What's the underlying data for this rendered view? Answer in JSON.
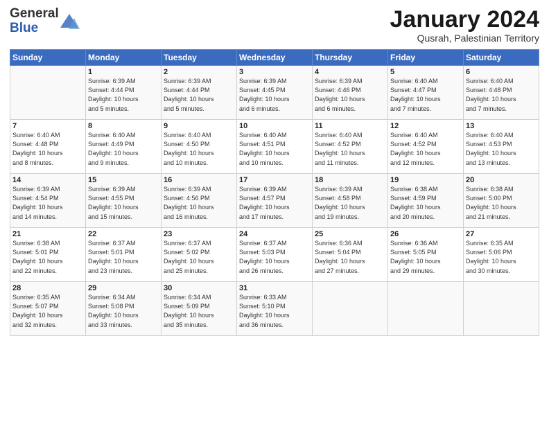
{
  "header": {
    "logo_general": "General",
    "logo_blue": "Blue",
    "month_title": "January 2024",
    "subtitle": "Qusrah, Palestinian Territory"
  },
  "days_of_week": [
    "Sunday",
    "Monday",
    "Tuesday",
    "Wednesday",
    "Thursday",
    "Friday",
    "Saturday"
  ],
  "weeks": [
    [
      {
        "day": "",
        "info": ""
      },
      {
        "day": "1",
        "info": "Sunrise: 6:39 AM\nSunset: 4:44 PM\nDaylight: 10 hours\nand 5 minutes."
      },
      {
        "day": "2",
        "info": "Sunrise: 6:39 AM\nSunset: 4:44 PM\nDaylight: 10 hours\nand 5 minutes."
      },
      {
        "day": "3",
        "info": "Sunrise: 6:39 AM\nSunset: 4:45 PM\nDaylight: 10 hours\nand 6 minutes."
      },
      {
        "day": "4",
        "info": "Sunrise: 6:39 AM\nSunset: 4:46 PM\nDaylight: 10 hours\nand 6 minutes."
      },
      {
        "day": "5",
        "info": "Sunrise: 6:40 AM\nSunset: 4:47 PM\nDaylight: 10 hours\nand 7 minutes."
      },
      {
        "day": "6",
        "info": "Sunrise: 6:40 AM\nSunset: 4:48 PM\nDaylight: 10 hours\nand 7 minutes."
      }
    ],
    [
      {
        "day": "7",
        "info": "Sunrise: 6:40 AM\nSunset: 4:48 PM\nDaylight: 10 hours\nand 8 minutes."
      },
      {
        "day": "8",
        "info": "Sunrise: 6:40 AM\nSunset: 4:49 PM\nDaylight: 10 hours\nand 9 minutes."
      },
      {
        "day": "9",
        "info": "Sunrise: 6:40 AM\nSunset: 4:50 PM\nDaylight: 10 hours\nand 10 minutes."
      },
      {
        "day": "10",
        "info": "Sunrise: 6:40 AM\nSunset: 4:51 PM\nDaylight: 10 hours\nand 10 minutes."
      },
      {
        "day": "11",
        "info": "Sunrise: 6:40 AM\nSunset: 4:52 PM\nDaylight: 10 hours\nand 11 minutes."
      },
      {
        "day": "12",
        "info": "Sunrise: 6:40 AM\nSunset: 4:52 PM\nDaylight: 10 hours\nand 12 minutes."
      },
      {
        "day": "13",
        "info": "Sunrise: 6:40 AM\nSunset: 4:53 PM\nDaylight: 10 hours\nand 13 minutes."
      }
    ],
    [
      {
        "day": "14",
        "info": "Sunrise: 6:39 AM\nSunset: 4:54 PM\nDaylight: 10 hours\nand 14 minutes."
      },
      {
        "day": "15",
        "info": "Sunrise: 6:39 AM\nSunset: 4:55 PM\nDaylight: 10 hours\nand 15 minutes."
      },
      {
        "day": "16",
        "info": "Sunrise: 6:39 AM\nSunset: 4:56 PM\nDaylight: 10 hours\nand 16 minutes."
      },
      {
        "day": "17",
        "info": "Sunrise: 6:39 AM\nSunset: 4:57 PM\nDaylight: 10 hours\nand 17 minutes."
      },
      {
        "day": "18",
        "info": "Sunrise: 6:39 AM\nSunset: 4:58 PM\nDaylight: 10 hours\nand 19 minutes."
      },
      {
        "day": "19",
        "info": "Sunrise: 6:38 AM\nSunset: 4:59 PM\nDaylight: 10 hours\nand 20 minutes."
      },
      {
        "day": "20",
        "info": "Sunrise: 6:38 AM\nSunset: 5:00 PM\nDaylight: 10 hours\nand 21 minutes."
      }
    ],
    [
      {
        "day": "21",
        "info": "Sunrise: 6:38 AM\nSunset: 5:01 PM\nDaylight: 10 hours\nand 22 minutes."
      },
      {
        "day": "22",
        "info": "Sunrise: 6:37 AM\nSunset: 5:01 PM\nDaylight: 10 hours\nand 23 minutes."
      },
      {
        "day": "23",
        "info": "Sunrise: 6:37 AM\nSunset: 5:02 PM\nDaylight: 10 hours\nand 25 minutes."
      },
      {
        "day": "24",
        "info": "Sunrise: 6:37 AM\nSunset: 5:03 PM\nDaylight: 10 hours\nand 26 minutes."
      },
      {
        "day": "25",
        "info": "Sunrise: 6:36 AM\nSunset: 5:04 PM\nDaylight: 10 hours\nand 27 minutes."
      },
      {
        "day": "26",
        "info": "Sunrise: 6:36 AM\nSunset: 5:05 PM\nDaylight: 10 hours\nand 29 minutes."
      },
      {
        "day": "27",
        "info": "Sunrise: 6:35 AM\nSunset: 5:06 PM\nDaylight: 10 hours\nand 30 minutes."
      }
    ],
    [
      {
        "day": "28",
        "info": "Sunrise: 6:35 AM\nSunset: 5:07 PM\nDaylight: 10 hours\nand 32 minutes."
      },
      {
        "day": "29",
        "info": "Sunrise: 6:34 AM\nSunset: 5:08 PM\nDaylight: 10 hours\nand 33 minutes."
      },
      {
        "day": "30",
        "info": "Sunrise: 6:34 AM\nSunset: 5:09 PM\nDaylight: 10 hours\nand 35 minutes."
      },
      {
        "day": "31",
        "info": "Sunrise: 6:33 AM\nSunset: 5:10 PM\nDaylight: 10 hours\nand 36 minutes."
      },
      {
        "day": "",
        "info": ""
      },
      {
        "day": "",
        "info": ""
      },
      {
        "day": "",
        "info": ""
      }
    ]
  ]
}
